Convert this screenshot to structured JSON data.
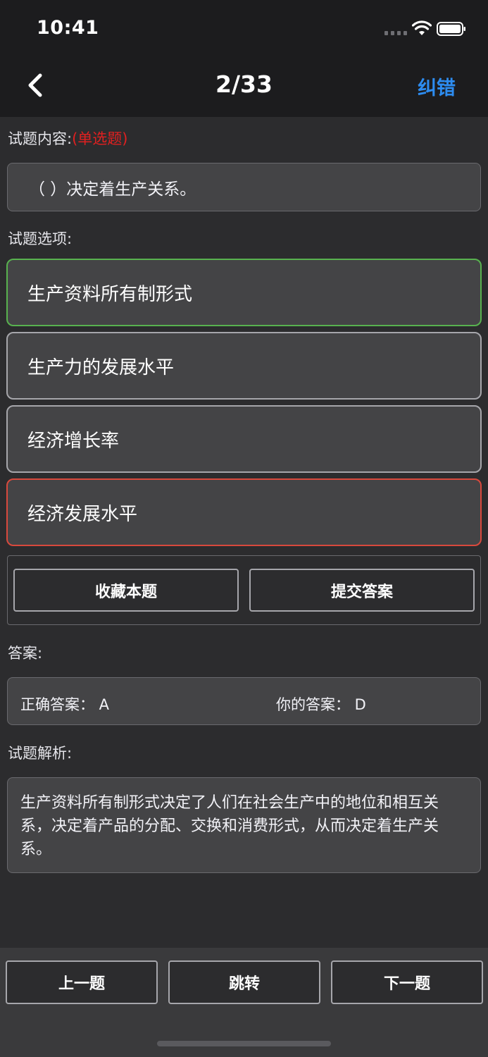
{
  "status_bar": {
    "time": "10:41"
  },
  "nav": {
    "title": "2/33",
    "action_label": "纠错"
  },
  "question": {
    "section_label": "试题内容:",
    "type_tag": "(单选题)",
    "text": "（        ）决定着生产关系。"
  },
  "options_section": {
    "label": "试题选项:",
    "items": [
      {
        "text": "生产资料所有制形式",
        "state": "correct"
      },
      {
        "text": "生产力的发展水平",
        "state": "normal"
      },
      {
        "text": "经济增长率",
        "state": "normal"
      },
      {
        "text": "经济发展水平",
        "state": "wrong"
      }
    ]
  },
  "actions": {
    "favorite_label": "收藏本题",
    "submit_label": "提交答案"
  },
  "answer": {
    "section_label": "答案:",
    "correct_text": "正确答案：  A",
    "yours_text": "你的答案：  D"
  },
  "explanation": {
    "section_label": "试题解析:",
    "text": "生产资料所有制形式决定了人们在社会生产中的地位和相互关系，决定着产品的分配、交换和消费形式，从而决定着生产关系。"
  },
  "bottom": {
    "prev_label": "上一题",
    "jump_label": "跳转",
    "next_label": "下一题"
  },
  "colors": {
    "accent": "#2d8cf0",
    "correct": "#58b24f",
    "wrong": "#d9493d",
    "tag": "#e02020"
  }
}
